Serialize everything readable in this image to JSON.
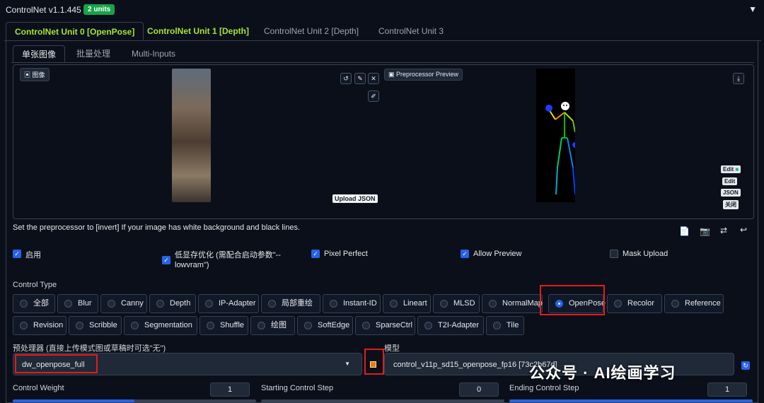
{
  "header": {
    "title": "ControlNet v1.1.445",
    "badge": "2 units",
    "collapse_glyph": "▼"
  },
  "unit_tabs": [
    "ControlNet Unit 0 [OpenPose]",
    "ControlNet Unit 1 [Depth]",
    "ControlNet Unit 2 [Depth]",
    "ControlNet Unit 3"
  ],
  "sub_tabs": [
    "单张图像",
    "批量处理",
    "Multi-Inputs"
  ],
  "image_panel": {
    "image_label": "图像",
    "upload_json": "Upload JSON",
    "preview_label": "Preprocessor Preview",
    "edit1": "Edit",
    "edit2": "Edit",
    "json": "JSON",
    "close": "关闭"
  },
  "note": "Set the preprocessor to [invert] If your image has white background and black lines.",
  "checkboxes": {
    "enable": "启用",
    "lowvram_line1": "低显存优化 (需配合启动参数\"--",
    "lowvram_line2": "lowvram\")",
    "pixel_perfect": "Pixel Perfect",
    "allow_preview": "Allow Preview",
    "mask_upload": "Mask Upload",
    "check_glyph": "✓"
  },
  "control_type": {
    "label": "Control Type",
    "row1": [
      "全部",
      "Blur",
      "Canny",
      "Depth",
      "IP-Adapter",
      "局部重绘",
      "Instant-ID",
      "Lineart",
      "MLSD",
      "NormalMap",
      "OpenPose",
      "Recolor",
      "Reference"
    ],
    "row2": [
      "Revision",
      "Scribble",
      "Segmentation",
      "Shuffle",
      "绘图",
      "SoftEdge",
      "SparseCtrl",
      "T2I-Adapter",
      "Tile"
    ],
    "selected": "OpenPose"
  },
  "preprocessor": {
    "label": "预处理器 (直接上传模式图或草稿时可选\"无\")",
    "value": "dw_openpose_full",
    "arrow": "▼"
  },
  "model": {
    "label": "模型",
    "value": "control_v11p_sd15_openpose_fp16 [73c2b67d]"
  },
  "sliders": {
    "weight_label": "Control Weight",
    "weight_value": "1",
    "weight_fraction": 0.5,
    "start_label": "Starting Control Step",
    "start_value": "0",
    "start_fraction": 0.0,
    "end_label": "Ending Control Step",
    "end_value": "1",
    "end_fraction": 1.0
  },
  "watermark": "公众号 · AI绘画学习",
  "colors": {
    "accent": "#a3e635",
    "badge": "#16a34a",
    "checkbox": "#2563eb",
    "highlight": "#e11d1d"
  }
}
